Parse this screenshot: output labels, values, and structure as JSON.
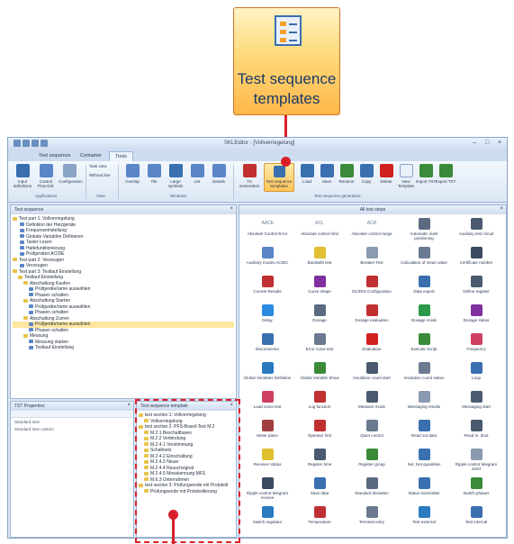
{
  "callout": {
    "line1": "Test sequence",
    "line2": "templates"
  },
  "window": {
    "title": "SKLEditor - [Vollverriegelung]",
    "controls": [
      "–",
      "□",
      "×"
    ]
  },
  "tabs": [
    "Test sequence",
    "Container",
    "Tools"
  ],
  "ribbon": {
    "groups": [
      {
        "label": "Applications",
        "buttons": [
          "Input definitions",
          "Control Flow Def.",
          "Configuration"
        ]
      },
      {
        "label": "View",
        "buttons": [
          "Task view",
          "Without line"
        ]
      },
      {
        "label": "Windows",
        "buttons": [
          "Overlap",
          "Tile",
          "Large symbols",
          "List",
          "Details"
        ]
      },
      {
        "label": "Test sequence generation",
        "buttons": [
          "TS Generation",
          "Test sequence templates",
          "Load",
          "Save",
          "Rename",
          "Copy",
          "Delete",
          "New Template",
          "Import TST",
          "Export TST"
        ]
      }
    ],
    "colors": {
      "accent": "#ffc45a",
      "brand": "#3a6fb0",
      "highlight": "#d9202a"
    }
  },
  "left_panel": {
    "title": "Test sequence",
    "tree": [
      {
        "label": "Test part 1: Vollverriegelung",
        "icon": "folder"
      },
      {
        "label": "Definition der Heizgeräte",
        "icon": "step"
      },
      {
        "label": "Frequenzeinstellung",
        "icon": "step"
      },
      {
        "label": "Globale Variablen Definieren",
        "icon": "step"
      },
      {
        "label": "Taster Lesen",
        "icon": "step"
      },
      {
        "label": "Haltefunktionierung",
        "icon": "step"
      },
      {
        "label": "Prüfgeräten ACIDE",
        "icon": "step"
      },
      {
        "label": "Test part 2: Verzeugen",
        "icon": "folder"
      },
      {
        "label": "Verzeugen",
        "icon": "step"
      },
      {
        "label": "Test part 3: Testlauf Einstellung",
        "icon": "folder"
      },
      {
        "label": "Testlauf Einstellung",
        "icon": "folder"
      },
      {
        "label": "Abschaltung Kaufen",
        "icon": "folder"
      },
      {
        "label": "Prüfgeräte/rame auswählen",
        "icon": "step"
      },
      {
        "label": "Phasen schalten",
        "icon": "step"
      },
      {
        "label": "Abschaltung Starten",
        "icon": "folder"
      },
      {
        "label": "Prüfgeräte/rame auswählen",
        "icon": "step"
      },
      {
        "label": "Phasen schalten",
        "icon": "step"
      },
      {
        "label": "Abschaltung Zurren",
        "icon": "folder"
      },
      {
        "label": "Prüfgeräte/rame auswählen",
        "icon": "step",
        "selected": true
      },
      {
        "label": "Phasen schalten",
        "icon": "step"
      },
      {
        "label": "Messung",
        "icon": "folder"
      },
      {
        "label": "Messung starten",
        "icon": "step"
      },
      {
        "label": "Testlauf Einstellung",
        "icon": "step"
      }
    ]
  },
  "steps_panel": {
    "title": "All test steps",
    "items": [
      {
        "label": "Absolute Control Error",
        "icon": "text-icon",
        "color": "#6a7a90",
        "glyph": "AACE"
      },
      {
        "label": "Absolute control limit",
        "icon": "text-icon",
        "color": "#6a7a90",
        "glyph": "ACL"
      },
      {
        "label": "Absolute control range",
        "icon": "text-icon",
        "color": "#6a7a90",
        "glyph": "ACR"
      },
      {
        "label": "Automatic mark positioning",
        "icon": "pin-icon",
        "color": "#5a6a80",
        "glyph": ""
      },
      {
        "label": "Auxiliary test circuit",
        "icon": "list-icon",
        "color": "#4a5a70",
        "glyph": ""
      },
      {
        "label": "Auxiliary modes ACIDC",
        "icon": "network-icon",
        "color": "#5a86c8",
        "glyph": ""
      },
      {
        "label": "Bandwith test",
        "icon": "lightning-icon",
        "color": "#e0c030",
        "glyph": ""
      },
      {
        "label": "Breaker Test",
        "icon": "breaker-icon",
        "color": "#8a9ab0",
        "glyph": ""
      },
      {
        "label": "Calculation of mean value",
        "icon": "grid-icon",
        "color": "#6a7a90",
        "glyph": ""
      },
      {
        "label": "Certificate number",
        "icon": "info-icon",
        "color": "#3a4a60",
        "glyph": ""
      },
      {
        "label": "Current Results",
        "icon": "chart-icon",
        "color": "#c03030",
        "glyph": ""
      },
      {
        "label": "Curve shape",
        "icon": "curve-icon",
        "color": "#8030a0",
        "glyph": ""
      },
      {
        "label": "DC/DIN Configuration",
        "icon": "dcdin-icon",
        "color": "#c03030",
        "glyph": ""
      },
      {
        "label": "Data export",
        "icon": "export-icon",
        "color": "#3a6fb0",
        "glyph": ""
      },
      {
        "label": "Define register",
        "icon": "register-icon",
        "color": "#4a5a70",
        "glyph": ""
      },
      {
        "label": "Delay",
        "icon": "clock-icon",
        "color": "#2a8ae0",
        "glyph": ""
      },
      {
        "label": "Dosage",
        "icon": "dosage-icon",
        "color": "#5a6a80",
        "glyph": ""
      },
      {
        "label": "Dosage evaluation",
        "icon": "dosage-eval-icon",
        "color": "#c03030",
        "glyph": ""
      },
      {
        "label": "Dosage mode",
        "icon": "dosage-mode-icon",
        "color": "#2a9a4a",
        "glyph": ""
      },
      {
        "label": "Dosage status",
        "icon": "dosage-status-icon",
        "color": "#8030a0",
        "glyph": ""
      },
      {
        "label": "Disconnector",
        "icon": "disconnector-icon",
        "color": "#3a6fb0",
        "glyph": ""
      },
      {
        "label": "Error curve test",
        "icon": "error-curve-icon",
        "color": "#6a7a90",
        "glyph": ""
      },
      {
        "label": "Evaluation",
        "icon": "exclaim-icon",
        "color": "#d02020",
        "glyph": ""
      },
      {
        "label": "Execute Script",
        "icon": "script-icon",
        "color": "#3a8a3a",
        "glyph": ""
      },
      {
        "label": "Frequency",
        "icon": "wave-icon",
        "color": "#d04060",
        "glyph": ""
      },
      {
        "label": "Global Variables Definition",
        "icon": "globe-icon",
        "color": "#2a7ac0",
        "glyph": ""
      },
      {
        "label": "Global Variable Show",
        "icon": "globe-show-icon",
        "color": "#3a8a3a",
        "glyph": ""
      },
      {
        "label": "Insulation count start",
        "icon": "count-start-icon",
        "color": "#4a5a70",
        "glyph": ""
      },
      {
        "label": "Insulation count status",
        "icon": "count-status-icon",
        "color": "#6a7a90",
        "glyph": ""
      },
      {
        "label": "Loop",
        "icon": "loop-icon",
        "color": "#3a6fb0",
        "glyph": ""
      },
      {
        "label": "Load curve test",
        "icon": "load-curve-icon",
        "color": "#d04060",
        "glyph": ""
      },
      {
        "label": "Log function",
        "icon": "log-icon",
        "color": "#c03030",
        "glyph": ""
      },
      {
        "label": "Measure mode",
        "icon": "measure-mode-icon",
        "color": "#4a5a70",
        "glyph": ""
      },
      {
        "label": "Messaging results",
        "icon": "messaging-icon",
        "color": "#8a9ab0",
        "glyph": ""
      },
      {
        "label": "Messaging start",
        "icon": "messaging-start-icon",
        "color": "#4a5a70",
        "glyph": ""
      },
      {
        "label": "Meter place",
        "icon": "meter-icon",
        "color": "#a04040",
        "glyph": ""
      },
      {
        "label": "Operator hint",
        "icon": "hint-icon",
        "color": "#c03030",
        "glyph": ""
      },
      {
        "label": "Quiet control",
        "icon": "quiet-icon",
        "color": "#6a7a90",
        "glyph": ""
      },
      {
        "label": "Read out data",
        "icon": "read-icon",
        "color": "#3a6fb0",
        "glyph": ""
      },
      {
        "label": "Read m. dout",
        "icon": "readm-icon",
        "color": "#4a5a70",
        "glyph": ""
      },
      {
        "label": "Receiver status",
        "icon": "receiver-icon",
        "color": "#e0c030",
        "glyph": ""
      },
      {
        "label": "Register time",
        "icon": "register-time-icon",
        "color": "#4a5a70",
        "glyph": ""
      },
      {
        "label": "Register group",
        "icon": "register-group-icon",
        "color": "#3a8a3a",
        "glyph": ""
      },
      {
        "label": "Set, Not quantities",
        "icon": "set-icon",
        "color": "#3a6fb0",
        "glyph": ""
      },
      {
        "label": "Ripple control telegram send",
        "icon": "ripple-send-icon",
        "color": "#8a9ab0",
        "glyph": ""
      },
      {
        "label": "Ripple control telegram receive",
        "icon": "question-icon",
        "color": "#3a4a60",
        "glyph": ""
      },
      {
        "label": "Save data",
        "icon": "save-data-icon",
        "color": "#3a6fb0",
        "glyph": ""
      },
      {
        "label": "Standard deviation",
        "icon": "std-icon",
        "color": "#5a6a80",
        "glyph": ""
      },
      {
        "label": "Status transmitter",
        "icon": "status-tx-icon",
        "color": "#3a6fb0",
        "glyph": ""
      },
      {
        "label": "Switch phases",
        "icon": "switch-phases-icon",
        "color": "#3a8a3a",
        "glyph": ""
      },
      {
        "label": "Switch regulator",
        "icon": "switch-reg-icon",
        "color": "#2a7ac0",
        "glyph": ""
      },
      {
        "label": "Temperature",
        "icon": "thermo-icon",
        "color": "#c03030",
        "glyph": ""
      },
      {
        "label": "Terminal entry",
        "icon": "terminal-icon",
        "color": "#6a7a90",
        "glyph": ""
      },
      {
        "label": "Test external",
        "icon": "test-ext-icon",
        "color": "#2a7ac0",
        "glyph": ""
      },
      {
        "label": "Test internal",
        "icon": "test-int-icon",
        "color": "#3a6fb0",
        "glyph": ""
      }
    ]
  },
  "properties_panel": {
    "title": "TST Properties",
    "rows": [
      "Standard time",
      "Standard time custom"
    ]
  },
  "template_panel": {
    "title": "Test sequence template",
    "tree": [
      {
        "label": "test section 1: Vollverriegelung",
        "icon": "folder"
      },
      {
        "label": "Vollverriegelung",
        "icon": "folder"
      },
      {
        "label": "test section 2: PFS-Board-Test M.2",
        "icon": "folder"
      },
      {
        "label": "M.2.1 Beschaltbaren",
        "icon": "folder"
      },
      {
        "label": "M.2.2 Verbindung",
        "icon": "folder"
      },
      {
        "label": "M.2.4.1 Verstimmung",
        "icon": "folder"
      },
      {
        "label": "Schaltnetz",
        "icon": "folder"
      },
      {
        "label": "M.2.4.2 Einschaltung",
        "icon": "folder"
      },
      {
        "label": "M.2.4.3 Neuer",
        "icon": "folder"
      },
      {
        "label": "M.2.4.4 Rauschsignal",
        "icon": "folder"
      },
      {
        "label": "M.2.4.5 Messkennung MFS",
        "icon": "folder"
      },
      {
        "label": "M.6.3 Unterrahmen",
        "icon": "folder"
      },
      {
        "label": "test section 3: Prüfungsende mit Protokoll",
        "icon": "folder"
      },
      {
        "label": "Prüfungsende mit Protokollierung",
        "icon": "folder"
      }
    ]
  }
}
